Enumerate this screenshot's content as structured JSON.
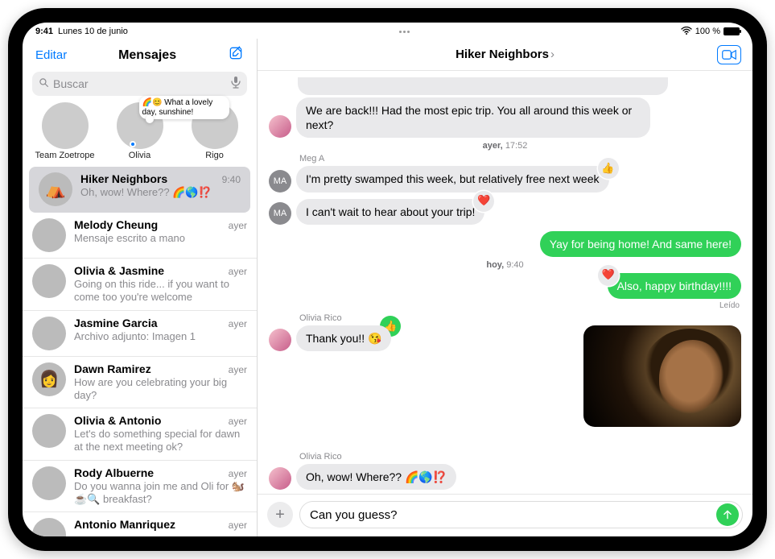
{
  "status": {
    "time": "9:41",
    "date": "Lunes 10 de junio",
    "battery_label": "100 %"
  },
  "sidebar": {
    "edit": "Editar",
    "title": "Mensajes",
    "search_placeholder": "Buscar",
    "pinned": [
      {
        "name": "Team Zoetrope",
        "preview": ""
      },
      {
        "name": "Olivia",
        "preview": "🌈😊 What a lovely day, sunshine!"
      },
      {
        "name": "Rigo",
        "preview": ""
      }
    ],
    "conversations": [
      {
        "name": "Hiker Neighbors",
        "time": "9:40",
        "preview": "Oh, wow! Where?? 🌈🌎⁉️",
        "selected": true,
        "avatar": "av-hiker",
        "icon": "⛺"
      },
      {
        "name": "Melody Cheung",
        "time": "ayer",
        "preview": "Mensaje escrito a mano",
        "avatar": "av-mel"
      },
      {
        "name": "Olivia & Jasmine",
        "time": "ayer",
        "preview": "Going on this ride... if you want to come too you're welcome",
        "avatar": "av-oj"
      },
      {
        "name": "Jasmine Garcia",
        "time": "ayer",
        "preview": "Archivo adjunto: Imagen 1",
        "avatar": "av-jas"
      },
      {
        "name": "Dawn Ramirez",
        "time": "ayer",
        "preview": "How are you celebrating your big day?",
        "avatar": "av-dawn",
        "icon": "👩"
      },
      {
        "name": "Olivia & Antonio",
        "time": "ayer",
        "preview": "Let's do something special for dawn at the next meeting ok?",
        "avatar": "av-oa"
      },
      {
        "name": "Rody Albuerne",
        "time": "ayer",
        "preview": "Do you wanna join me and Oli for 🐿️☕🔍 breakfast?",
        "avatar": "av-rody"
      },
      {
        "name": "Antonio Manriquez",
        "time": "ayer",
        "preview": "",
        "avatar": "av-ant"
      }
    ]
  },
  "chat": {
    "title": "Hiker Neighbors",
    "messages": {
      "m0": "We are back!!! Had the most epic trip. You all around this week or next?",
      "t1_label": "ayer,",
      "t1_time": "17:52",
      "s1": "Meg A",
      "m1": "I'm pretty swamped this week, but relatively free next week",
      "m2": "I can't wait to hear about your trip!",
      "m3": "Yay for being home! And same here!",
      "t2_label": "hoy,",
      "t2_time": "9:40",
      "m4": "Also, happy birthday!!!!",
      "m4_status": "Leído",
      "s2": "Olivia Rico",
      "m5": "Thank you!! 😘",
      "s3": "Olivia Rico",
      "m6": "Oh, wow! Where?? 🌈🌎⁉️"
    },
    "composer": {
      "text": "Can you guess?"
    },
    "reactions": {
      "thumbs": "👍",
      "heart": "❤️"
    }
  }
}
